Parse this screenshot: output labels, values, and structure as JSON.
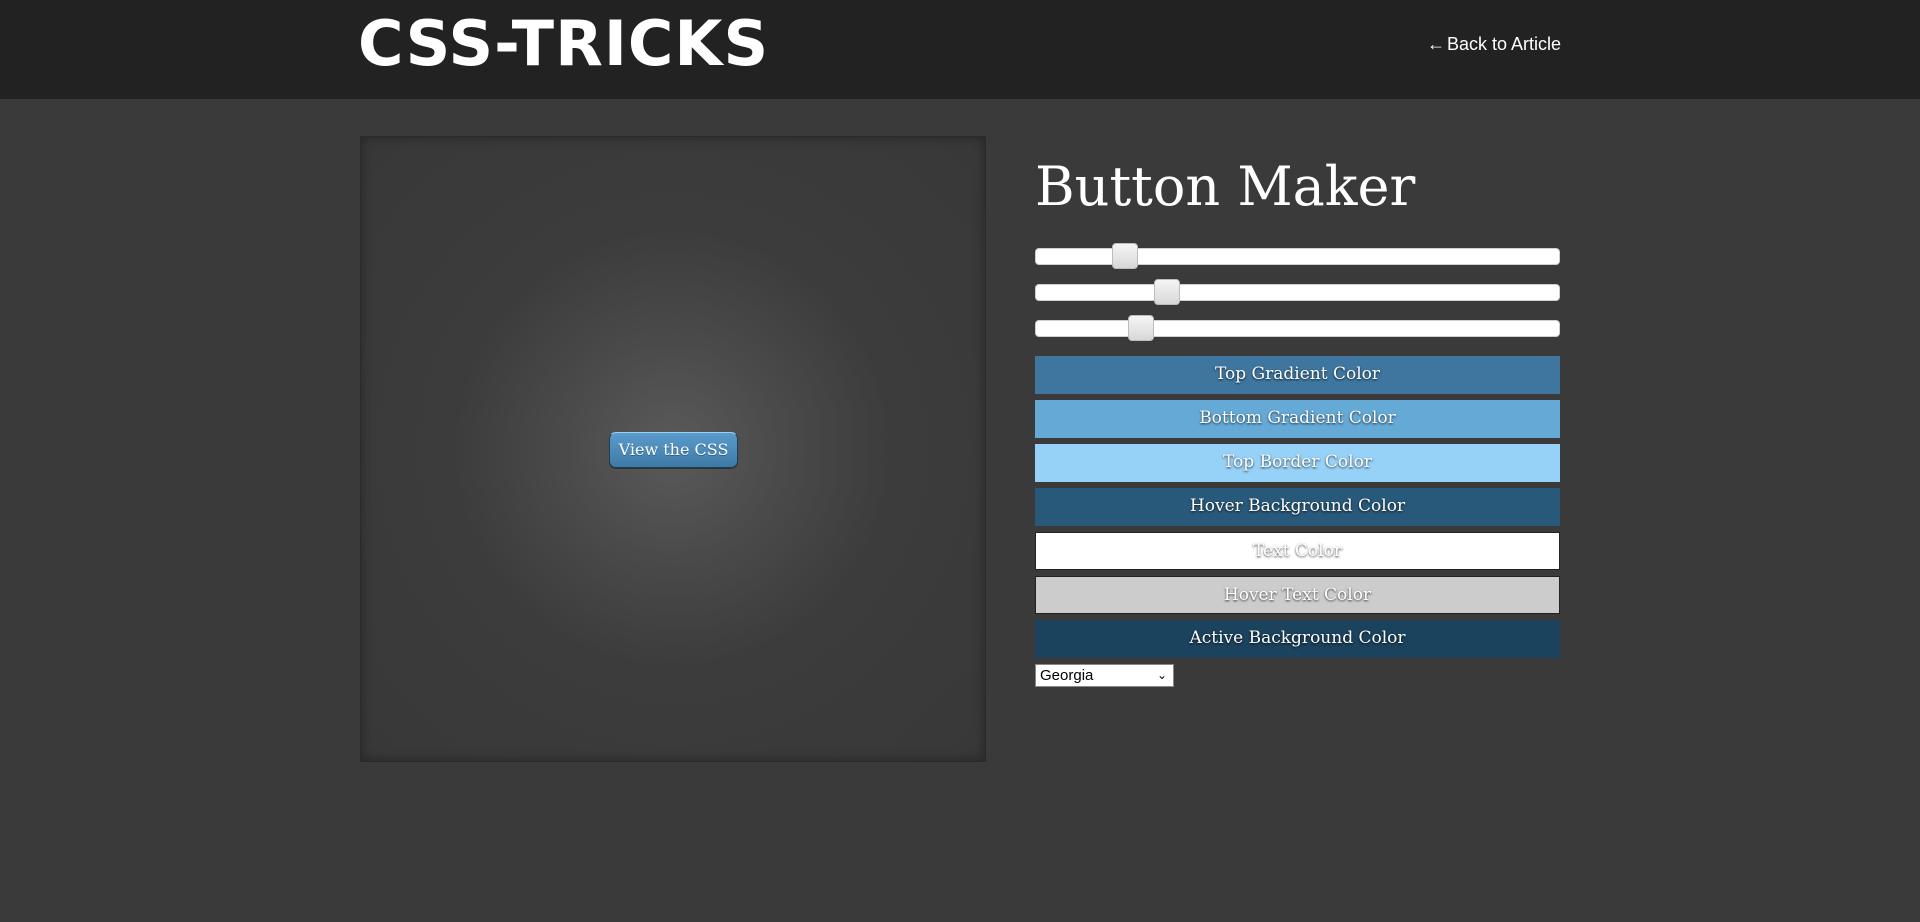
{
  "header": {
    "logo_text": "CSS-TRICKS",
    "back_link_arrow": "←",
    "back_link_label": "Back to Article"
  },
  "preview": {
    "button_label": "View the CSS"
  },
  "panel": {
    "title": "Button Maker",
    "sliders": [
      {
        "name": "slider-1",
        "value_fraction": 0.17
      },
      {
        "name": "slider-2",
        "value_fraction": 0.25
      },
      {
        "name": "slider-3",
        "value_fraction": 0.2
      }
    ],
    "color_buttons": [
      {
        "label": "Top Gradient Color",
        "color": "#3e769f"
      },
      {
        "label": "Bottom Gradient Color",
        "color": "#65a9d7"
      },
      {
        "label": "Top Border Color",
        "color": "#96d1f8"
      },
      {
        "label": "Hover Background Color",
        "color": "#28597a"
      },
      {
        "label": "Text Color",
        "color": "#ffffff"
      },
      {
        "label": "Hover Text Color",
        "color": "#cccccc"
      },
      {
        "label": "Active Background Color",
        "color": "#1b435e"
      }
    ],
    "font_select": {
      "selected": "Georgia",
      "chevron_icon": "chevron-down-icon"
    }
  },
  "colors": {
    "page_background": "#3a3a3a",
    "header_background": "#222222"
  }
}
